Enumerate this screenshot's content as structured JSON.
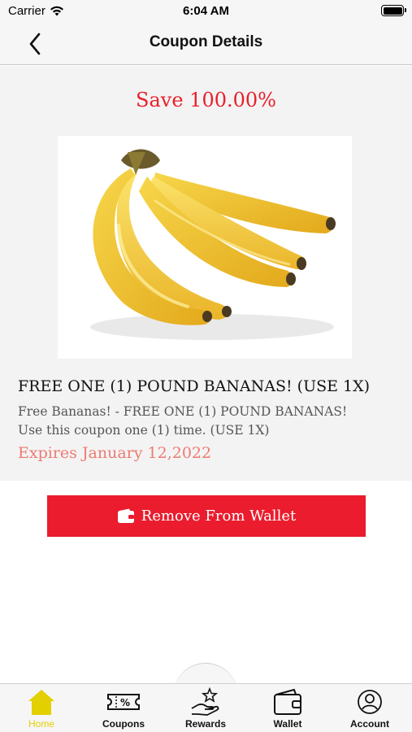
{
  "status_bar": {
    "carrier": "Carrier",
    "time": "6:04 AM"
  },
  "nav": {
    "title": "Coupon Details",
    "back_icon": "chevron-left-icon"
  },
  "coupon": {
    "save_text": "Save 100.00%",
    "image": "bananas",
    "title": "FREE ONE (1) POUND BANANAS! (USE 1X)",
    "description_line1": "Free Bananas! - FREE ONE (1) POUND BANANAS!",
    "description_line2": "Use this coupon one (1) time. (USE 1X)",
    "expiry": "Expires January 12,2022"
  },
  "wallet_button": {
    "label": "Remove From Wallet",
    "icon": "wallet-icon"
  },
  "tabs": [
    {
      "label": "Home",
      "icon": "home-icon",
      "active": true
    },
    {
      "label": "Coupons",
      "icon": "coupon-icon",
      "active": false
    },
    {
      "label": "Rewards",
      "icon": "rewards-icon",
      "active": false
    },
    {
      "label": "Wallet",
      "icon": "wallet-icon",
      "active": false
    },
    {
      "label": "Account",
      "icon": "account-icon",
      "active": false
    }
  ],
  "colors": {
    "accent_red": "#ea1c2d",
    "save_red": "#e8202a",
    "expiry_pink": "#ee7a72",
    "active_tab": "#e3d000"
  }
}
